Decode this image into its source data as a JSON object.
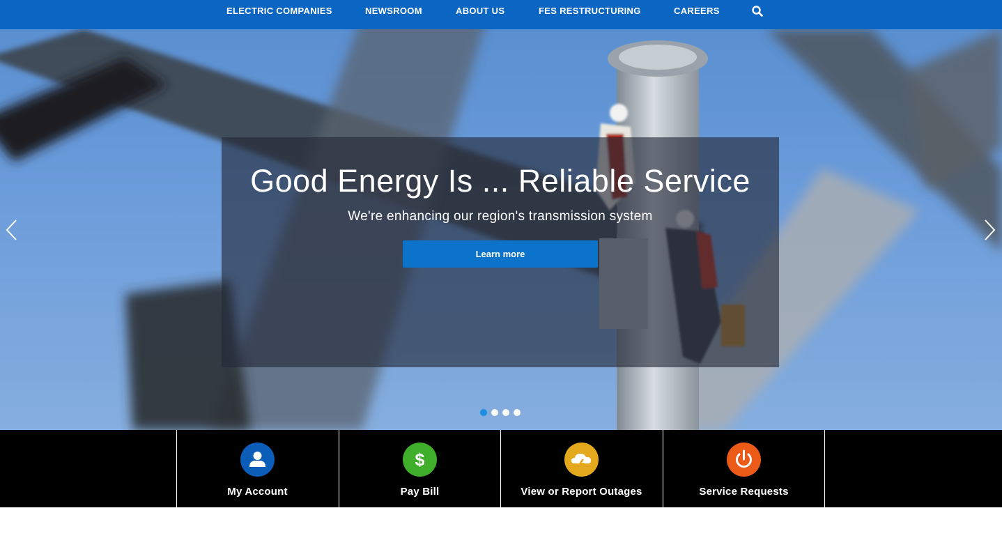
{
  "nav": {
    "items": [
      {
        "label": "ELECTRIC COMPANIES"
      },
      {
        "label": "NEWSROOM"
      },
      {
        "label": "ABOUT US"
      },
      {
        "label": "FES RESTRUCTURING"
      },
      {
        "label": "CAREERS"
      }
    ],
    "search_icon": "search-icon",
    "background": "#0b66c3"
  },
  "hero": {
    "title": "Good Energy Is ... Reliable Service",
    "subtitle": "We're enhancing our region's transmission system",
    "cta_label": "Learn more",
    "cta_color": "#0b73c9",
    "prev_icon": "chevron-left-icon",
    "next_icon": "chevron-right-icon",
    "slides_total": 4,
    "active_slide": 1
  },
  "quick_links": [
    {
      "label": "My Account",
      "icon": "user-icon",
      "color": "#0b5db8"
    },
    {
      "label": "Pay Bill",
      "icon": "dollar-icon",
      "color": "#3fae2a"
    },
    {
      "label": "View or Report Outages",
      "icon": "storm-cloud-icon",
      "color": "#e3a81c"
    },
    {
      "label": "Service Requests",
      "icon": "power-icon",
      "color": "#ec5a17"
    }
  ]
}
